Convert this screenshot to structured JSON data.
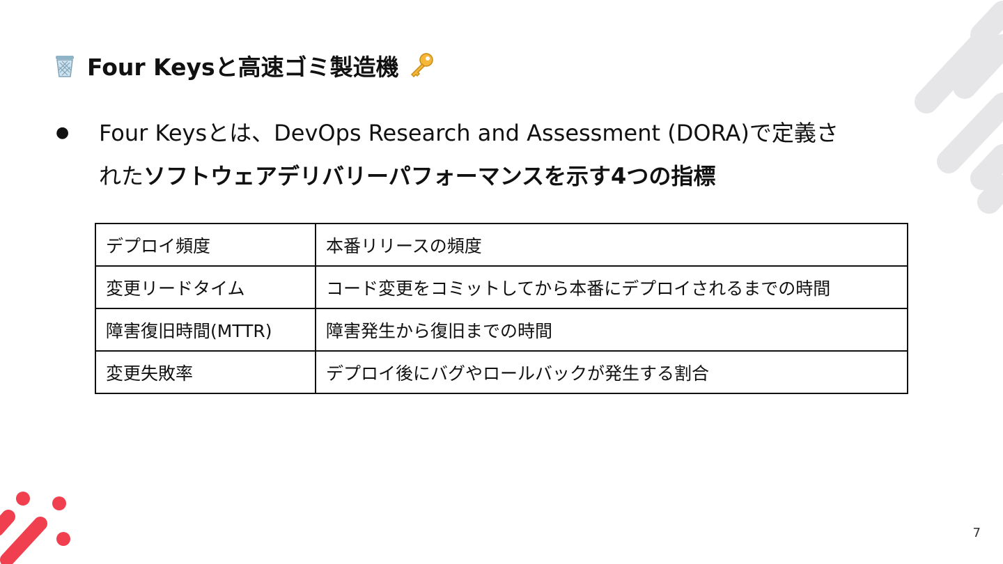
{
  "slide": {
    "title": "Four Keysと高速ゴミ製造機",
    "bullet": {
      "line1": "Four Keysとは、DevOps Research and Assessment (DORA)で定義さ",
      "line2_prefix": "れた",
      "line2_bold": "ソフトウェアデリバリーパフォーマンスを示す4つの指標"
    },
    "table": {
      "rows": [
        {
          "key": "デプロイ頻度",
          "description": "本番リリースの頻度"
        },
        {
          "key": "変更リードタイム",
          "description": "コード変更をコミットしてから本番にデプロイされるまでの時間"
        },
        {
          "key": "障害復旧時間(MTTR)",
          "description": "障害発生から復旧までの時間"
        },
        {
          "key": "変更失敗率",
          "description": "デプロイ後にバグやロールバックが発生する割合"
        }
      ]
    },
    "page_number": "7"
  },
  "icons": {
    "title_left": "wastebasket-icon",
    "title_right": "key-icon"
  },
  "colors": {
    "accent_red": "#f0404f",
    "deco_gray": "#e6e6e8",
    "text": "#111111"
  }
}
